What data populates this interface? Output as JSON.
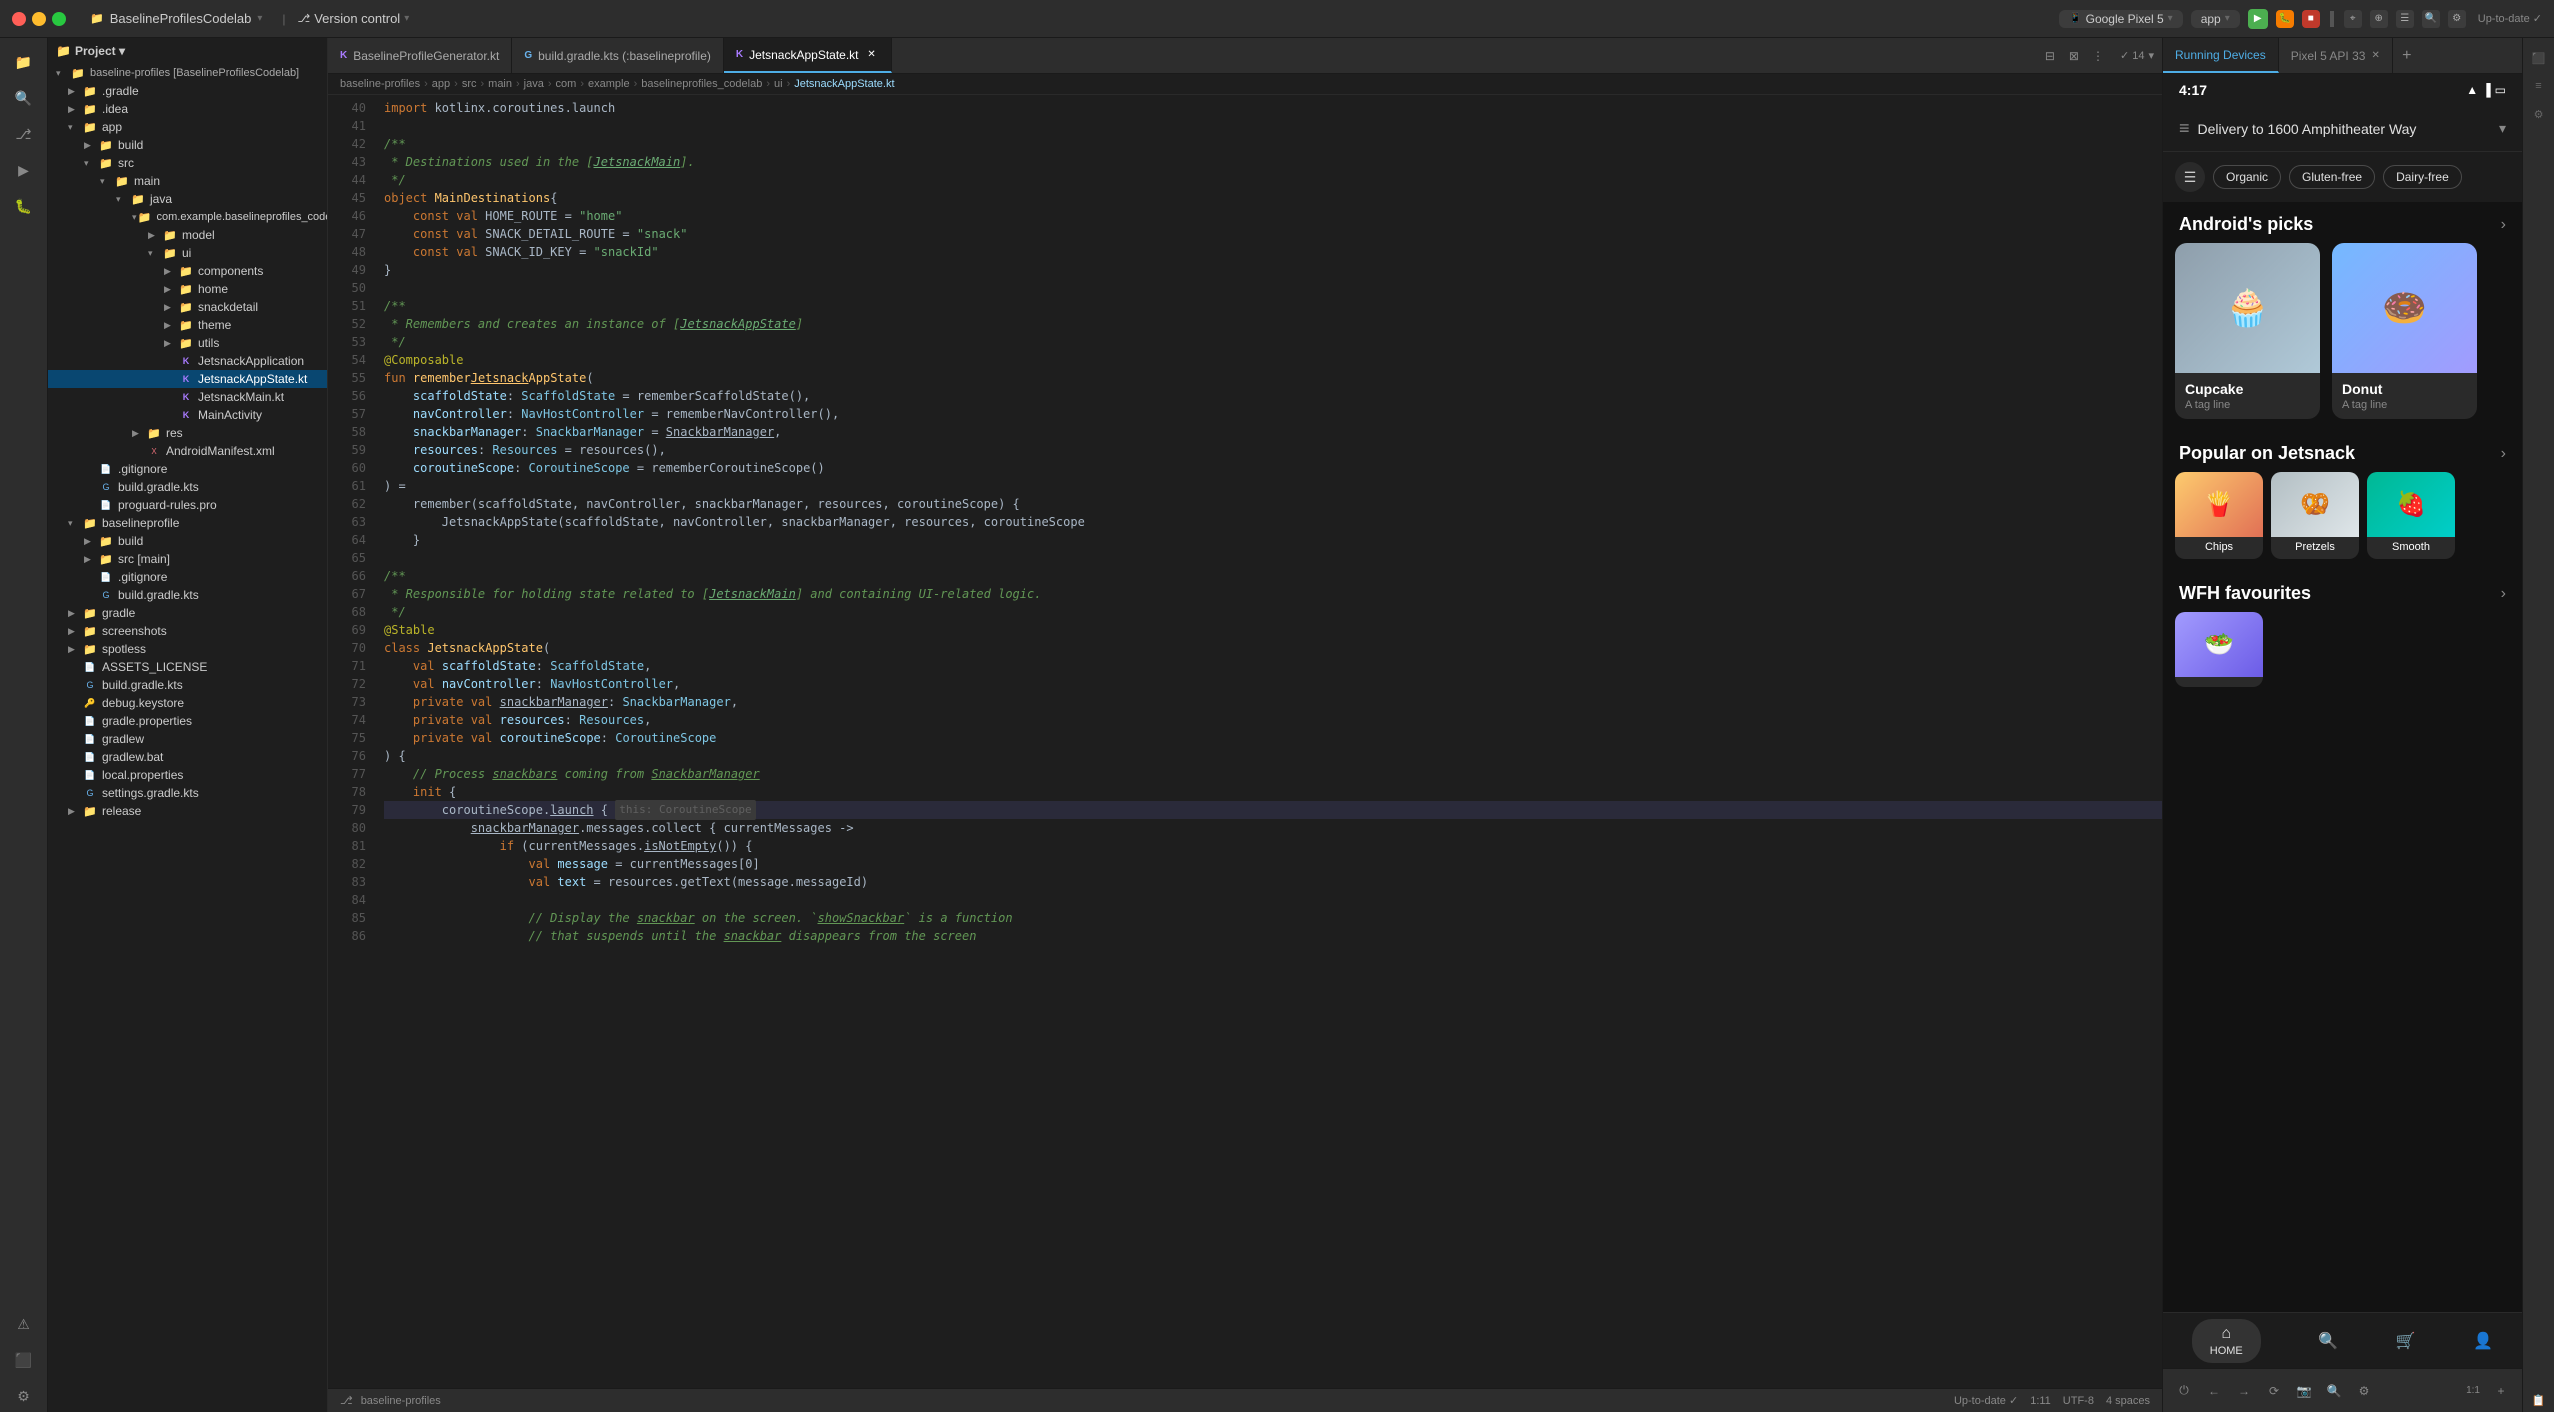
{
  "titlebar": {
    "project_label": "Project",
    "project_name": "BaselineProfilesCodelab",
    "vc_label": "Version control",
    "device_name": "Google Pixel 5",
    "app_label": "app",
    "run_icon": "▶",
    "pixel_api": "Pixel 5 API 33"
  },
  "filetree": {
    "header": "Project ▾",
    "root": "baseline-profiles [BaselineProfilesCodelab]",
    "items": [
      {
        "label": ".gradle",
        "type": "folder",
        "depth": 1,
        "open": false
      },
      {
        "label": ".idea",
        "type": "folder",
        "depth": 1,
        "open": false
      },
      {
        "label": "app",
        "type": "folder",
        "depth": 1,
        "open": true
      },
      {
        "label": "build",
        "type": "folder",
        "depth": 2,
        "open": false
      },
      {
        "label": "src",
        "type": "folder",
        "depth": 2,
        "open": true
      },
      {
        "label": "main",
        "type": "folder",
        "depth": 3,
        "open": true
      },
      {
        "label": "java",
        "type": "folder",
        "depth": 4,
        "open": true
      },
      {
        "label": "com.example.baselineprofiles_codel",
        "type": "folder",
        "depth": 5,
        "open": true
      },
      {
        "label": "model",
        "type": "folder",
        "depth": 6,
        "open": false
      },
      {
        "label": "ui",
        "type": "folder",
        "depth": 6,
        "open": true
      },
      {
        "label": "components",
        "type": "folder",
        "depth": 7,
        "open": false
      },
      {
        "label": "home",
        "type": "folder",
        "depth": 7,
        "open": false
      },
      {
        "label": "snackdetail",
        "type": "folder",
        "depth": 7,
        "open": false
      },
      {
        "label": "theme",
        "type": "folder",
        "depth": 7,
        "open": false
      },
      {
        "label": "utils",
        "type": "folder",
        "depth": 7,
        "open": false
      },
      {
        "label": "JetsnackApplication",
        "type": "kotlin",
        "depth": 7,
        "open": false
      },
      {
        "label": "JetsnackAppState.kt",
        "type": "kotlin",
        "depth": 7,
        "open": false,
        "selected": true
      },
      {
        "label": "JetsnackMain.kt",
        "type": "kotlin",
        "depth": 7,
        "open": false
      },
      {
        "label": "MainActivity",
        "type": "kotlin",
        "depth": 7,
        "open": false
      },
      {
        "label": "res",
        "type": "folder",
        "depth": 4,
        "open": false
      },
      {
        "label": "AndroidManifest.xml",
        "type": "xml",
        "depth": 4,
        "open": false
      },
      {
        "label": ".gitignore",
        "type": "file",
        "depth": 2,
        "open": false
      },
      {
        "label": "build.gradle.kts",
        "type": "gradle",
        "depth": 2,
        "open": false
      },
      {
        "label": "proguard-rules.pro",
        "type": "file",
        "depth": 2,
        "open": false
      },
      {
        "label": "baselineprofile",
        "type": "folder",
        "depth": 1,
        "open": true
      },
      {
        "label": "build",
        "type": "folder",
        "depth": 2,
        "open": false
      },
      {
        "label": "src [main]",
        "type": "folder",
        "depth": 2,
        "open": false
      },
      {
        "label": ".gitignore",
        "type": "file",
        "depth": 2,
        "open": false
      },
      {
        "label": "build.gradle.kts",
        "type": "gradle",
        "depth": 2,
        "open": false
      },
      {
        "label": "gradle",
        "type": "folder",
        "depth": 1,
        "open": false
      },
      {
        "label": "screenshots",
        "type": "folder",
        "depth": 1,
        "open": false
      },
      {
        "label": "spotless",
        "type": "folder",
        "depth": 1,
        "open": false
      },
      {
        "label": "ASSETS_LICENSE",
        "type": "file",
        "depth": 1,
        "open": false
      },
      {
        "label": "build.gradle.kts",
        "type": "gradle",
        "depth": 1,
        "open": false
      },
      {
        "label": "debug.keystore",
        "type": "file",
        "depth": 1,
        "open": false
      },
      {
        "label": "gradle.properties",
        "type": "file",
        "depth": 1,
        "open": false
      },
      {
        "label": "gradlew",
        "type": "file",
        "depth": 1,
        "open": false
      },
      {
        "label": "gradlew.bat",
        "type": "file",
        "depth": 1,
        "open": false
      },
      {
        "label": "local.properties",
        "type": "file",
        "depth": 1,
        "open": false
      },
      {
        "label": "settings.gradle.kts",
        "type": "gradle",
        "depth": 1,
        "open": false
      },
      {
        "label": "release",
        "type": "folder",
        "depth": 1,
        "open": false
      }
    ]
  },
  "tabs": [
    {
      "label": "BaselineProfileGenerator.kt",
      "active": false,
      "icon": "K"
    },
    {
      "label": "build.gradle.kts (:baselineprofile)",
      "active": false,
      "icon": "G"
    },
    {
      "label": "JetsnackAppState.kt",
      "active": true,
      "icon": "K"
    }
  ],
  "editor": {
    "filename": "JetsnackAppState.kt",
    "lines": [
      {
        "num": 40,
        "code": "import kotlinx.coroutines.launch"
      },
      {
        "num": 41,
        "code": ""
      },
      {
        "num": 42,
        "code": "/**"
      },
      {
        "num": 43,
        "code": " * Destinations used in the [JetsnackMain]."
      },
      {
        "num": 44,
        "code": " */"
      },
      {
        "num": 45,
        "code": "object MainDestinations {"
      },
      {
        "num": 46,
        "code": "    const val HOME_ROUTE = \"home\""
      },
      {
        "num": 47,
        "code": "    const val SNACK_DETAIL_ROUTE = \"snack\""
      },
      {
        "num": 48,
        "code": "    const val SNACK_ID_KEY = \"snackId\""
      },
      {
        "num": 49,
        "code": "}"
      },
      {
        "num": 50,
        "code": ""
      },
      {
        "num": 51,
        "code": "/**"
      },
      {
        "num": 52,
        "code": " * Remembers and creates an instance of [JetsnackAppState]"
      },
      {
        "num": 53,
        "code": " */"
      },
      {
        "num": 54,
        "code": "@Composable"
      },
      {
        "num": 55,
        "code": "fun rememberJetsnackAppState("
      },
      {
        "num": 56,
        "code": "    scaffoldState: ScaffoldState = rememberScaffoldState(),"
      },
      {
        "num": 57,
        "code": "    navController: NavHostController = rememberNavController(),"
      },
      {
        "num": 58,
        "code": "    snackbarManager: SnackbarManager = SnackbarManager,"
      },
      {
        "num": 59,
        "code": "    resources: Resources = resources(),"
      },
      {
        "num": 60,
        "code": "    coroutineScope: CoroutineScope = rememberCoroutineScope()"
      },
      {
        "num": 61,
        "code": ") ="
      },
      {
        "num": 62,
        "code": "    remember(scaffoldState, navController, snackbarManager, resources, coroutineScope) {"
      },
      {
        "num": 63,
        "code": "        JetsnackAppState(scaffoldState, navController, snackbarManager, resources, coroutineScope"
      },
      {
        "num": 64,
        "code": "    }"
      },
      {
        "num": 65,
        "code": ""
      },
      {
        "num": 66,
        "code": "/**"
      },
      {
        "num": 67,
        "code": " * Responsible for holding state related to [JetsnackMain] and containing UI-related logic."
      },
      {
        "num": 68,
        "code": " */"
      },
      {
        "num": 69,
        "code": "@Stable"
      },
      {
        "num": 70,
        "code": "class JetsnackAppState("
      },
      {
        "num": 71,
        "code": "    val scaffoldState: ScaffoldState,"
      },
      {
        "num": 72,
        "code": "    val navController: NavHostController,"
      },
      {
        "num": 73,
        "code": "    private val snackbarManager: SnackbarManager,"
      },
      {
        "num": 74,
        "code": "    private val resources: Resources,"
      },
      {
        "num": 75,
        "code": "    private val coroutineScope: CoroutineScope"
      },
      {
        "num": 76,
        "code": ") {"
      },
      {
        "num": 77,
        "code": "    // Process snackbars coming from SnackbarManager"
      },
      {
        "num": 78,
        "code": "    init {"
      },
      {
        "num": 79,
        "code": "        coroutineScope.launch { this: CoroutineScope"
      },
      {
        "num": 80,
        "code": "            snackbarManager.messages.collect { currentMessages ->"
      },
      {
        "num": 81,
        "code": "                if (currentMessages.isNotEmpty()) {"
      },
      {
        "num": 82,
        "code": "                    val message = currentMessages[0]"
      },
      {
        "num": 83,
        "code": "                    val text = resources.getText(message.messageId)"
      },
      {
        "num": 84,
        "code": ""
      },
      {
        "num": 85,
        "code": "                    // Display the snackbar on the screen. `showSnackbar` is a function"
      },
      {
        "num": 86,
        "code": "                    // that suspends until the snackbar disappears from the screen"
      }
    ]
  },
  "breadcrumb": {
    "items": [
      "baseline-profiles",
      "app",
      "src",
      "main",
      "java",
      "com",
      "example",
      "baselineprofiles_codelab",
      "ui",
      "JetsnackAppState.kt"
    ]
  },
  "device": {
    "time": "4:17",
    "status_icons": [
      "wifi",
      "signal",
      "battery"
    ],
    "header_text": "Delivery to 1600 Amphitheater Way",
    "filter_chips": [
      "Organic",
      "Gluten-free",
      "Dairy-free"
    ],
    "sections": [
      {
        "title": "Android's picks",
        "cards": [
          {
            "name": "Cupcake",
            "tagline": "A tag line",
            "bg": "cupcake"
          },
          {
            "name": "Donut",
            "tagline": "A tag line",
            "bg": "donut"
          }
        ]
      },
      {
        "title": "Popular on Jetsnack",
        "cards": [
          {
            "name": "Chips",
            "bg": "chips"
          },
          {
            "name": "Pretzels",
            "bg": "pretzels"
          },
          {
            "name": "Smooth",
            "bg": "smooth"
          }
        ]
      },
      {
        "title": "WFH favourites",
        "cards": [
          {
            "name": "",
            "bg": "wfh1"
          }
        ]
      }
    ],
    "nav_items": [
      "HOME",
      "Search",
      "Cart",
      "Profile"
    ]
  },
  "running_devices_tab": "Running Devices",
  "pixel_tab": "Pixel 5 API 33",
  "status": {
    "branch": "baseline-profiles",
    "path": "app > src > main > java > com > example > baselineprofiles_codelab > ui > JetsnackAppState.kt",
    "line": "1:11",
    "encoding": "UTF-8",
    "indent": "4 spaces",
    "status_right": "Up-to-date ✓"
  }
}
